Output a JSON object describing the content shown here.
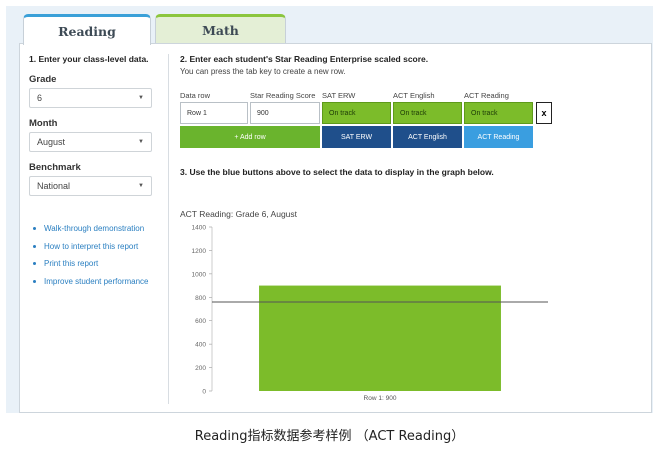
{
  "tabs": [
    {
      "label": "Reading",
      "active": true
    },
    {
      "label": "Math",
      "active": false
    }
  ],
  "left": {
    "section_title": "1. Enter your class-level data.",
    "grade": {
      "label": "Grade",
      "value": "6"
    },
    "month": {
      "label": "Month",
      "value": "August"
    },
    "benchmark": {
      "label": "Benchmark",
      "value": "National"
    },
    "links": [
      "Walk-through demonstration",
      "How to interpret this report",
      "Print this report",
      "Improve student performance"
    ]
  },
  "step2": {
    "title": "2. Enter each student's Star Reading Enterprise scaled score.",
    "subtitle": "You can press the tab key to create a new row.",
    "headers": [
      "Data row",
      "Star Reading Score",
      "SAT ERW",
      "ACT English",
      "ACT Reading"
    ],
    "row": {
      "name": "Row 1",
      "score": "900",
      "sat": "On track",
      "act_english": "On track",
      "act_reading": "On track"
    },
    "add_row": "+ Add row",
    "buttons": [
      "SAT ERW",
      "ACT English",
      "ACT Reading"
    ],
    "remove": "x"
  },
  "step3": {
    "title": "3. Use the blue buttons above to select the data to display in the graph below."
  },
  "chart_data": {
    "type": "bar",
    "title": "ACT Reading: Grade 6, August",
    "categories": [
      "Row 1: 900"
    ],
    "values": [
      900
    ],
    "benchmark": 760,
    "ylim": [
      0,
      1400
    ],
    "yticks": [
      0,
      200,
      400,
      600,
      800,
      1000,
      1200,
      1400
    ],
    "grid": false,
    "colors": {
      "bar": "#7cbc2a",
      "line": "#555555"
    }
  },
  "caption": "Reading指标数据参考样例 （ACT Reading）",
  "colors": {
    "tab_blue": "#3aa0d8",
    "tab_green": "#8cc63f",
    "add_row": "#6ab42d",
    "btn_dark": "#1f4f8b",
    "btn_active": "#3a9ee0"
  }
}
